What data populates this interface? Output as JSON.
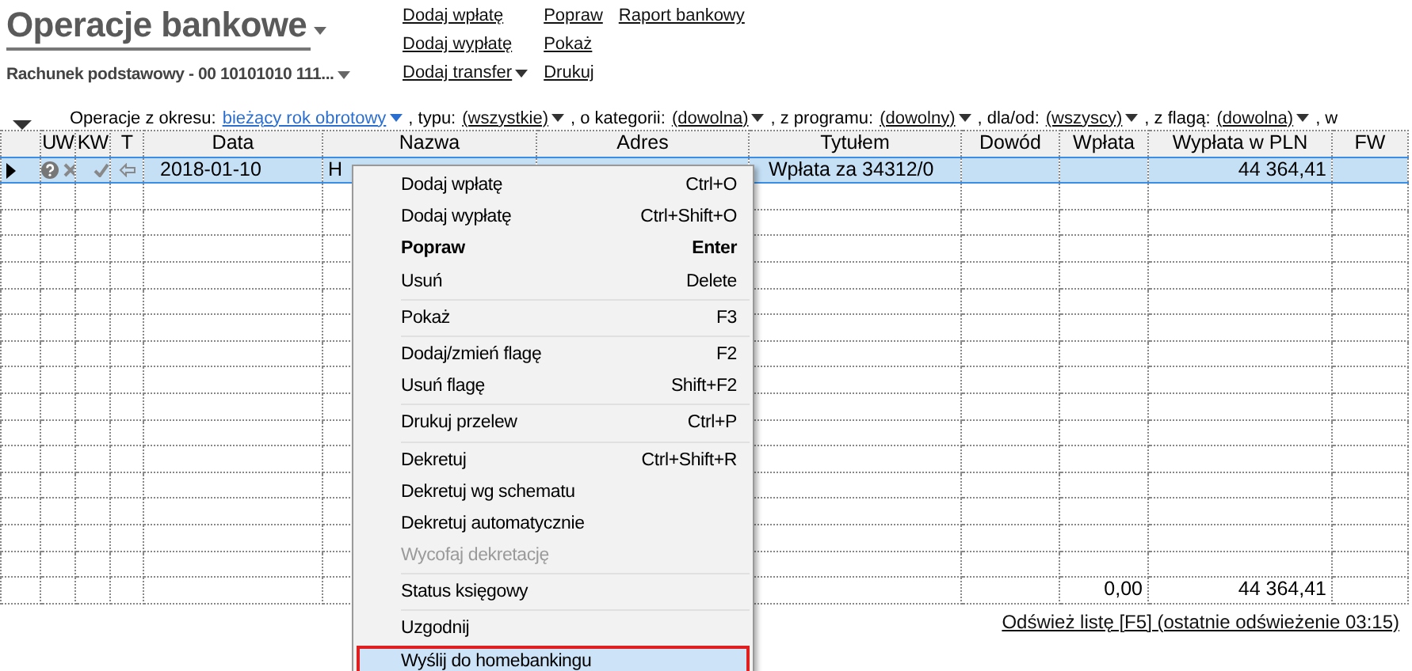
{
  "header": {
    "title": "Operacje bankowe",
    "account": "Rachunek podstawowy - 00 10101010 111...",
    "actions": [
      {
        "label": "Dodaj wpłatę"
      },
      {
        "label": "Dodaj wypłatę"
      },
      {
        "label": "Dodaj transfer",
        "dropdown": true
      },
      {
        "label": "Popraw"
      },
      {
        "label": "Pokaż"
      },
      {
        "label": "Drukuj"
      },
      {
        "label": "Raport bankowy"
      }
    ]
  },
  "filters": [
    {
      "label": "Operacje z okresu:",
      "value": "bieżący rok obrotowy",
      "active": true
    },
    {
      "label": ", typu:",
      "value": "(wszystkie)",
      "active": false
    },
    {
      "label": ", o kategorii:",
      "value": "(dowolna)",
      "active": false
    },
    {
      "label": ", z programu:",
      "value": "(dowolny)",
      "active": false
    },
    {
      "label": ", dla/od:",
      "value": "(wszyscy)",
      "active": false
    },
    {
      "label": ", z flagą:",
      "value": "(dowolna)",
      "active": false
    }
  ],
  "filters_tail": ", w",
  "table": {
    "columns": [
      "",
      "UW",
      "KW",
      "T",
      "Data",
      "Nazwa",
      "Adres",
      "Tytułem",
      "Dowód",
      "Wpłata",
      "Wypłata w PLN",
      "FW"
    ],
    "rows": [
      {
        "selected": true,
        "cells": [
          "",
          "",
          "",
          "",
          "2018-01-10",
          "H",
          "",
          "Wpłata za 34312/0",
          "",
          "",
          "44 364,41",
          ""
        ]
      }
    ],
    "totals": {
      "wplata": "0,00",
      "wyplata_pln": "44 364,41"
    }
  },
  "refresh_link": "Odśwież listę [F5] (ostatnie odświeżenie 03:15)",
  "context_menu": [
    {
      "kind": "item",
      "label": "Dodaj wpłatę",
      "shortcut": "Ctrl+O",
      "default": false,
      "disabled": false,
      "selected": false
    },
    {
      "kind": "item",
      "label": "Dodaj wypłatę",
      "shortcut": "Ctrl+Shift+O",
      "default": false,
      "disabled": false,
      "selected": false
    },
    {
      "kind": "item",
      "label": "Popraw",
      "shortcut": "Enter",
      "default": true,
      "disabled": false,
      "selected": false
    },
    {
      "kind": "item",
      "label": "Usuń",
      "shortcut": "Delete",
      "default": false,
      "disabled": false,
      "selected": false
    },
    {
      "kind": "separator"
    },
    {
      "kind": "item",
      "label": "Pokaż",
      "shortcut": "F3",
      "default": false,
      "disabled": false,
      "selected": false
    },
    {
      "kind": "separator"
    },
    {
      "kind": "item",
      "label": "Dodaj/zmień flagę",
      "shortcut": "F2",
      "default": false,
      "disabled": false,
      "selected": false
    },
    {
      "kind": "item",
      "label": "Usuń flagę",
      "shortcut": "Shift+F2",
      "default": false,
      "disabled": false,
      "selected": false
    },
    {
      "kind": "separator"
    },
    {
      "kind": "item",
      "label": "Drukuj przelew",
      "shortcut": "Ctrl+P",
      "default": false,
      "disabled": false,
      "selected": false
    },
    {
      "kind": "separator"
    },
    {
      "kind": "item",
      "label": "Dekretuj",
      "shortcut": "Ctrl+Shift+R",
      "default": false,
      "disabled": false,
      "selected": false
    },
    {
      "kind": "item",
      "label": "Dekretuj wg schematu",
      "default": false,
      "disabled": false,
      "selected": false
    },
    {
      "kind": "item",
      "label": "Dekretuj automatycznie",
      "default": false,
      "disabled": false,
      "selected": false
    },
    {
      "kind": "item",
      "label": "Wycofaj dekretację",
      "default": false,
      "disabled": true,
      "selected": false
    },
    {
      "kind": "separator"
    },
    {
      "kind": "item",
      "label": "Status księgowy",
      "default": false,
      "disabled": false,
      "selected": false
    },
    {
      "kind": "separator"
    },
    {
      "kind": "item",
      "label": "Uzgodnij",
      "default": false,
      "disabled": false,
      "selected": false
    },
    {
      "kind": "item",
      "label": "Wyślij do homebankingu",
      "default": false,
      "disabled": false,
      "selected": true
    }
  ]
}
